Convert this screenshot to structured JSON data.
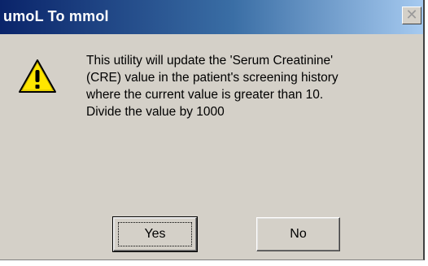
{
  "window": {
    "title": "umoL To mmol",
    "close_glyph": "✕"
  },
  "message": {
    "icon": "warning-icon",
    "lines": [
      "This utility will update the 'Serum Creatinine'",
      "(CRE) value in the patient's screening history",
      "where the current value is greater than 10.",
      "Divide the value by 1000"
    ]
  },
  "buttons": {
    "yes_label": "Yes",
    "no_label": "No"
  },
  "colors": {
    "title_gradient_start": "#0a246a",
    "title_gradient_end": "#a6caf0",
    "dialog_face": "#d4d0c8",
    "warning_yellow": "#ffe600"
  }
}
